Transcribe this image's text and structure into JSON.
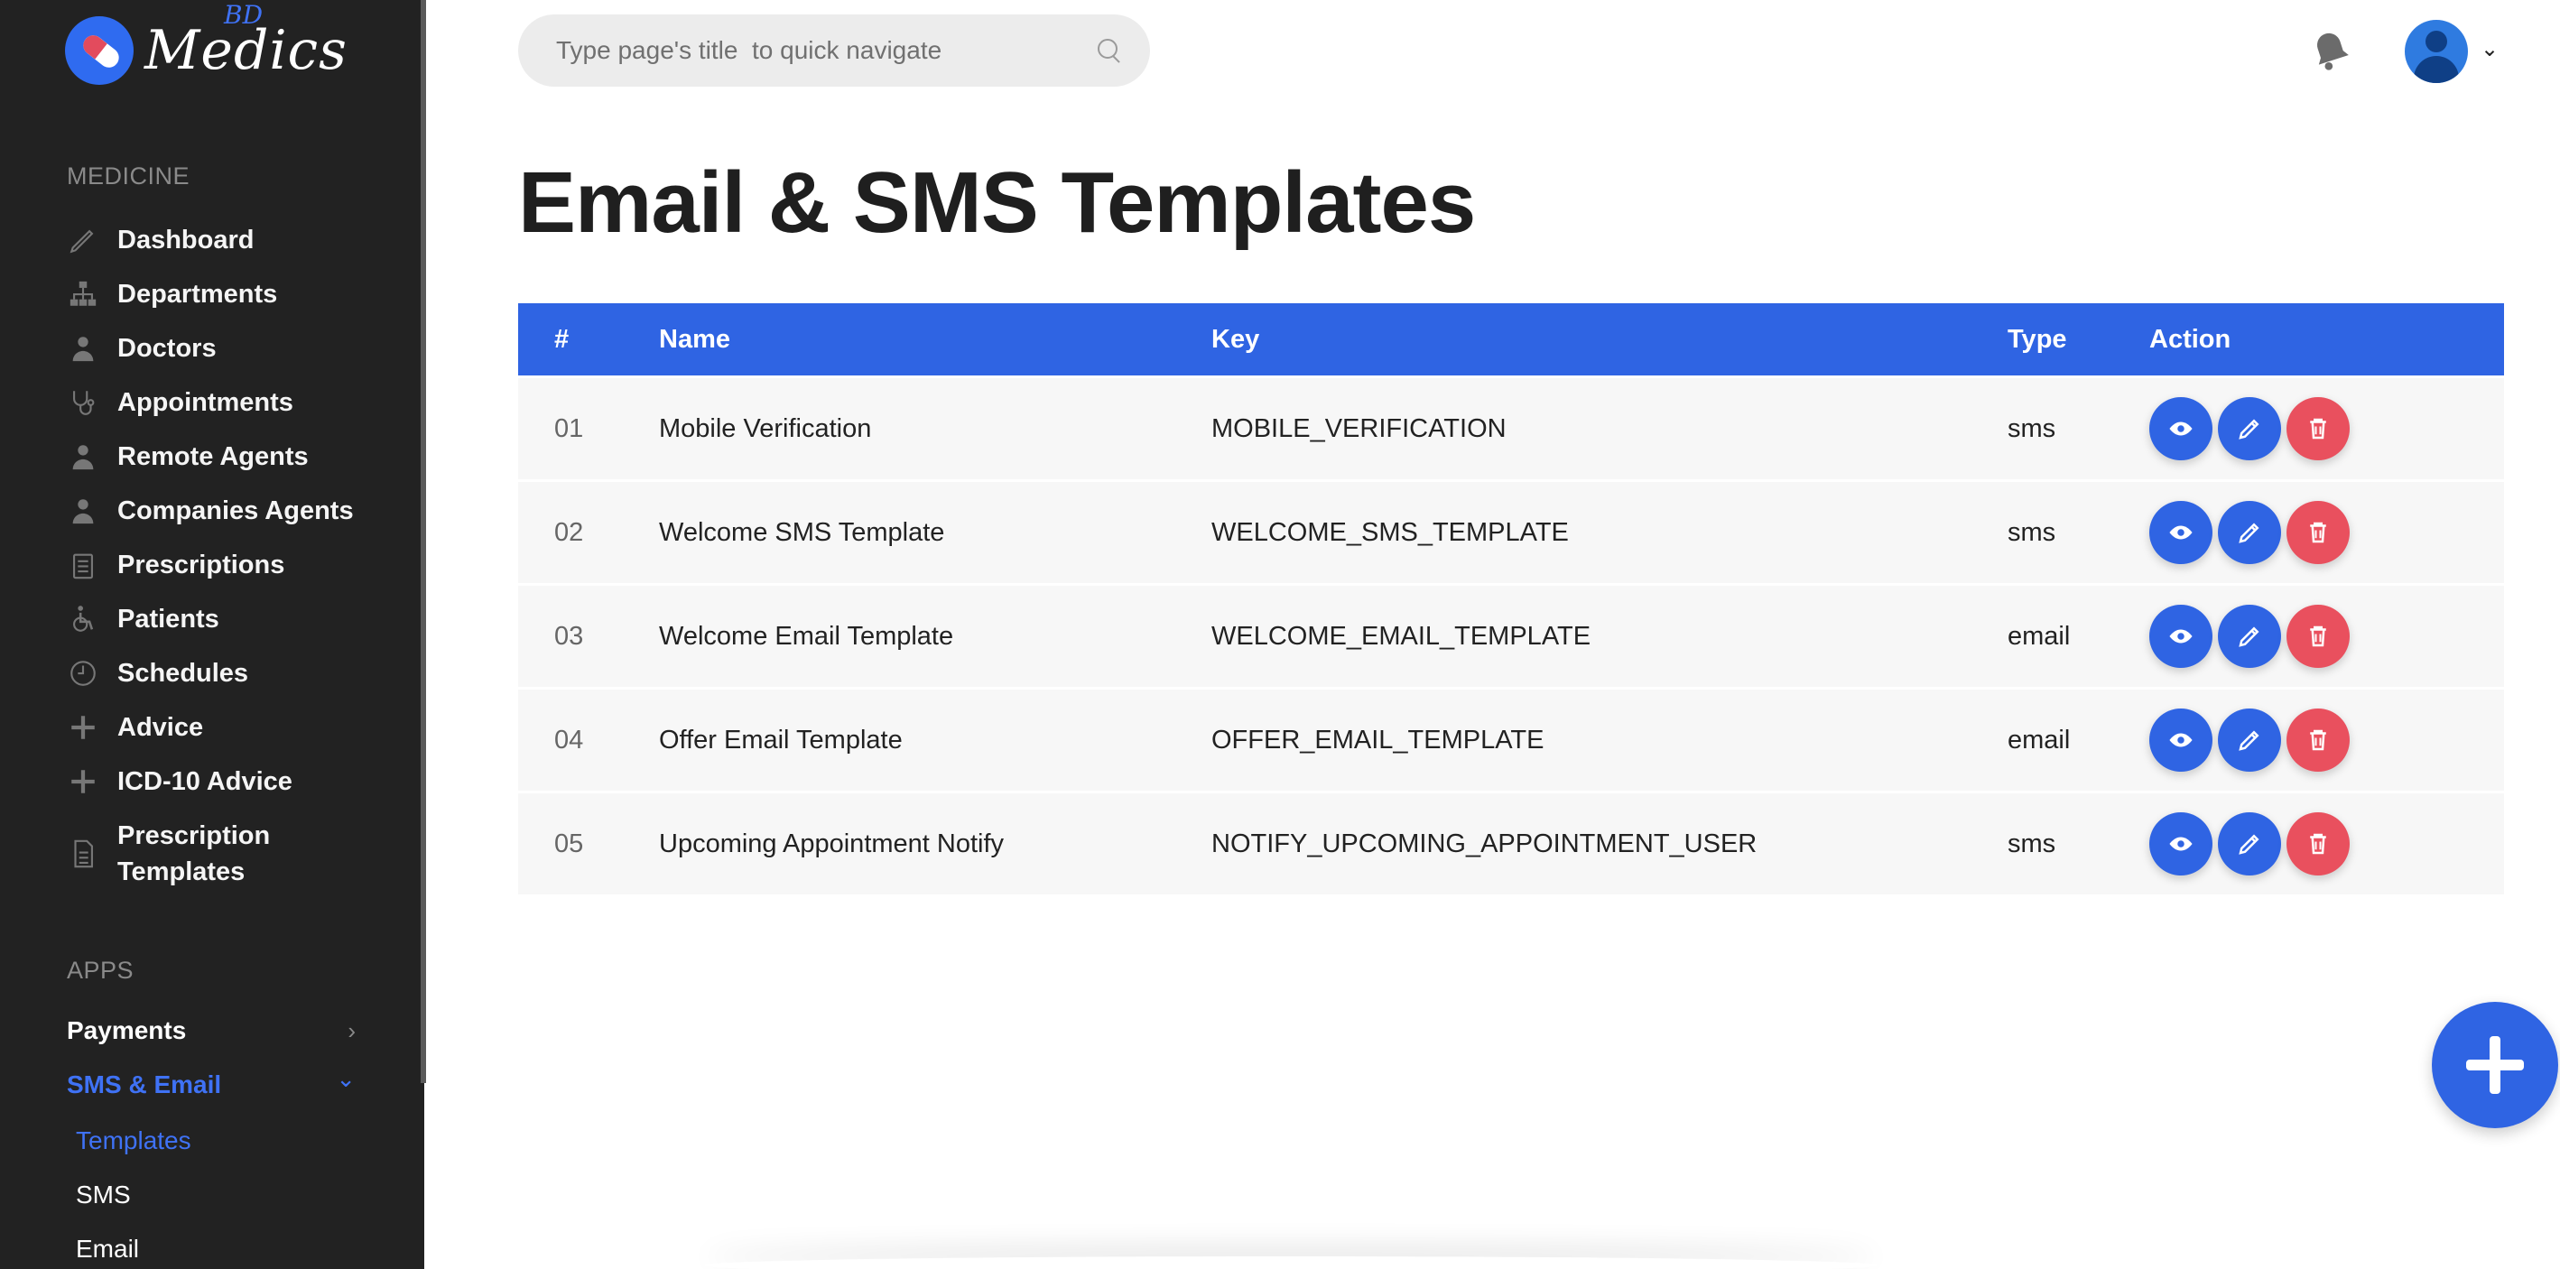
{
  "brand": {
    "name": "Medics",
    "suffix": "BD"
  },
  "sidebar": {
    "section_medicine": "MEDICINE",
    "items": [
      {
        "label": "Dashboard",
        "icon": "pen-icon"
      },
      {
        "label": "Departments",
        "icon": "hierarchy-icon"
      },
      {
        "label": "Doctors",
        "icon": "doctor-icon"
      },
      {
        "label": "Appointments",
        "icon": "stethoscope-icon"
      },
      {
        "label": "Remote Agents",
        "icon": "agent-icon"
      },
      {
        "label": "Companies Agents",
        "icon": "agent-icon"
      },
      {
        "label": "Prescriptions",
        "icon": "clipboard-icon"
      },
      {
        "label": "Patients",
        "icon": "wheelchair-icon"
      },
      {
        "label": "Schedules",
        "icon": "clock-icon"
      },
      {
        "label": "Advice",
        "icon": "plus-icon"
      },
      {
        "label": "ICD-10 Advice",
        "icon": "plus-icon"
      },
      {
        "label_line1": "Prescription",
        "label_line2": "Templates",
        "icon": "document-icon"
      }
    ],
    "section_apps": "APPS",
    "apps": [
      {
        "label": "Payments",
        "chevron": "›"
      },
      {
        "label": "SMS & Email",
        "chevron": "⌄"
      }
    ],
    "sub_items": [
      "Templates",
      "SMS",
      "Email"
    ]
  },
  "header": {
    "search_placeholder": "Type page's title  to quick navigate",
    "accent": "#2f64e3"
  },
  "page": {
    "title": "Email & SMS Templates"
  },
  "table": {
    "headers": {
      "num": "#",
      "name": "Name",
      "key": "Key",
      "type": "Type",
      "action": "Action"
    },
    "rows": [
      {
        "num": "01",
        "name": "Mobile Verification",
        "key": "MOBILE_VERIFICATION",
        "type": "sms"
      },
      {
        "num": "02",
        "name": "Welcome SMS Template",
        "key": "WELCOME_SMS_TEMPLATE",
        "type": "sms"
      },
      {
        "num": "03",
        "name": "Welcome Email Template",
        "key": "WELCOME_EMAIL_TEMPLATE",
        "type": "email"
      },
      {
        "num": "04",
        "name": "Offer Email Template",
        "key": "OFFER_EMAIL_TEMPLATE",
        "type": "email"
      },
      {
        "num": "05",
        "name": "Upcoming Appointment Notify",
        "key": "NOTIFY_UPCOMING_APPOINTMENT_USER",
        "type": "sms"
      }
    ]
  },
  "colors": {
    "primary": "#2f64e3",
    "danger": "#e9505e",
    "sidebar_bg": "#222222"
  }
}
